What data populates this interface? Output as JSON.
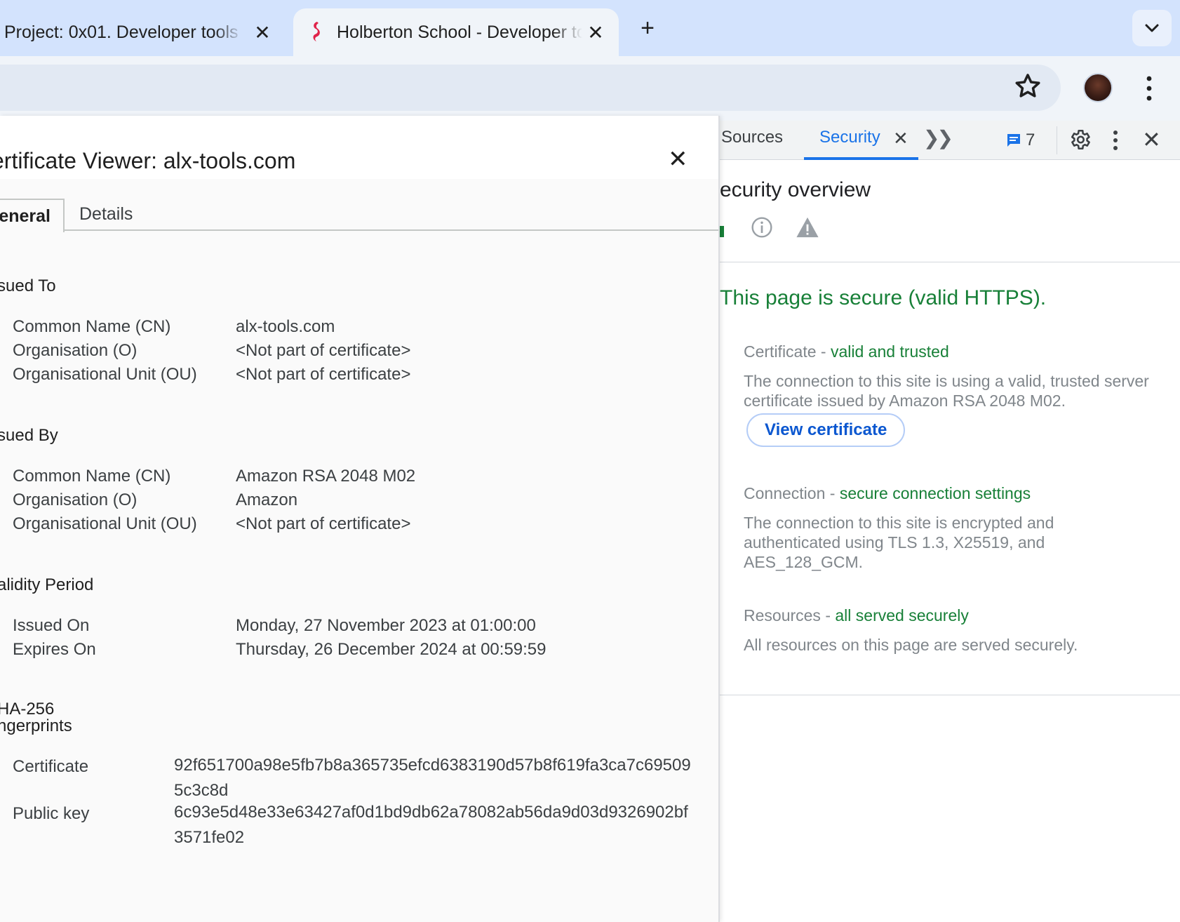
{
  "browser": {
    "tabs": [
      {
        "title": "Project: 0x01. Developer tools"
      },
      {
        "title": "Holberton School - Developer tools"
      }
    ],
    "accent": "#d3e3fd"
  },
  "devtools": {
    "tabs": {
      "sources": "Sources",
      "security": "Security"
    },
    "issues_count": "7",
    "overview_title": "ecurity overview",
    "headline": "This page is secure (valid HTTPS).",
    "certificate": {
      "label": "Certificate - ",
      "status": "valid and trusted",
      "description": "The connection to this site is using a valid, trusted server certificate issued by Amazon RSA 2048 M02.",
      "button": "View certificate"
    },
    "connection": {
      "label": "Connection - ",
      "status": "secure connection settings",
      "description": "The connection to this site is encrypted and authenticated using TLS 1.3, X25519, and AES_128_GCM."
    },
    "resources": {
      "label": "Resources - ",
      "status": "all served securely",
      "description": "All resources on this page are served securely."
    },
    "colors": {
      "secure": "#188038",
      "link": "#1a73e8"
    }
  },
  "cert_viewer": {
    "title": "ertificate Viewer: alx-tools.com",
    "tabs": {
      "general": "eneral",
      "details": "Details"
    },
    "issued_to": {
      "heading": "sued To",
      "rows": [
        {
          "key": "Common Name (CN)",
          "value": "alx-tools.com"
        },
        {
          "key": "Organisation (O)",
          "value": "<Not part of certificate>"
        },
        {
          "key": "Organisational Unit (OU)",
          "value": "<Not part of certificate>"
        }
      ]
    },
    "issued_by": {
      "heading": "sued By",
      "rows": [
        {
          "key": "Common Name (CN)",
          "value": "Amazon RSA 2048 M02"
        },
        {
          "key": "Organisation (O)",
          "value": "Amazon"
        },
        {
          "key": "Organisational Unit (OU)",
          "value": "<Not part of certificate>"
        }
      ]
    },
    "validity": {
      "heading": "alidity Period",
      "rows": [
        {
          "key": "Issued On",
          "value": "Monday, 27 November 2023 at 01:00:00"
        },
        {
          "key": "Expires On",
          "value": "Thursday, 26 December 2024 at 00:59:59"
        }
      ]
    },
    "fingerprints": {
      "heading_line1": "HA-256",
      "heading_line2": "ngerprints",
      "rows": [
        {
          "key": "Certificate",
          "value": "92f651700a98e5fb7b8a365735efcd6383190d57b8f619fa3ca7c695095c3c8d"
        },
        {
          "key": "Public key",
          "value": "6c93e5d48e33e63427af0d1bd9db62a78082ab56da9d03d9326902bf3571fe02"
        }
      ]
    }
  }
}
